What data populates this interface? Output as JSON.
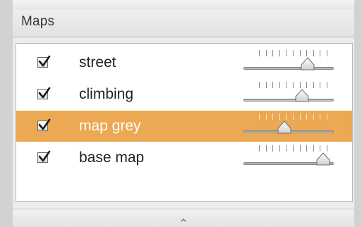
{
  "panel": {
    "title": "Maps"
  },
  "layers": [
    {
      "label": "street",
      "checked": true,
      "selected": false,
      "opacity": 0.75
    },
    {
      "label": "climbing",
      "checked": true,
      "selected": false,
      "opacity": 0.68
    },
    {
      "label": "map grey",
      "checked": true,
      "selected": true,
      "opacity": 0.44
    },
    {
      "label": "base map",
      "checked": true,
      "selected": false,
      "opacity": 0.96
    }
  ],
  "colors": {
    "selection": "#eca852",
    "window_background": "#ececec",
    "list_background": "#ffffff"
  },
  "icons": {
    "checkbox_mark": "checkmark-icon",
    "slider_thumb": "triangle-thumb-icon",
    "resize_grip": "chevron-up-icon"
  }
}
